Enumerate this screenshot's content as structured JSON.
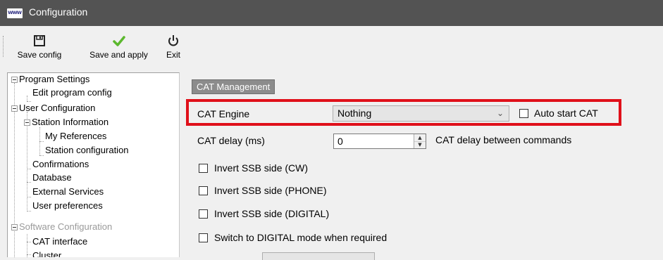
{
  "window": {
    "title": "Configuration",
    "app_icon_text": "www"
  },
  "toolbar": {
    "save_config_label": "Save config",
    "save_apply_label": "Save and apply",
    "exit_label": "Exit"
  },
  "tree": {
    "program_settings": "Program Settings",
    "edit_program_config": "Edit program config",
    "user_configuration": "User Configuration",
    "station_information": "Station Information",
    "my_references": "My References",
    "station_configuration": "Station configuration",
    "confirmations": "Confirmations",
    "database": "Database",
    "external_services": "External Services",
    "user_preferences": "User preferences",
    "software_configuration": "Software Configuration",
    "cat_interface": "CAT interface",
    "cluster": "Cluster"
  },
  "cat": {
    "section_title": "CAT Management",
    "engine_label": "CAT Engine",
    "engine_value": "Nothing",
    "auto_start_label": "Auto start CAT",
    "delay_label": "CAT delay (ms)",
    "delay_value": "0",
    "delay_help": "CAT delay between commands",
    "invert_cw": "Invert SSB side (CW)",
    "invert_phone": "Invert SSB side (PHONE)",
    "invert_digital": "Invert SSB side (DIGITAL)",
    "switch_digital": "Switch to DIGITAL mode when required"
  },
  "colors": {
    "titlebar": "#535353",
    "highlight": "#e0101a",
    "section_bg": "#8c8c8c",
    "save_apply_check": "#5cb82e"
  }
}
